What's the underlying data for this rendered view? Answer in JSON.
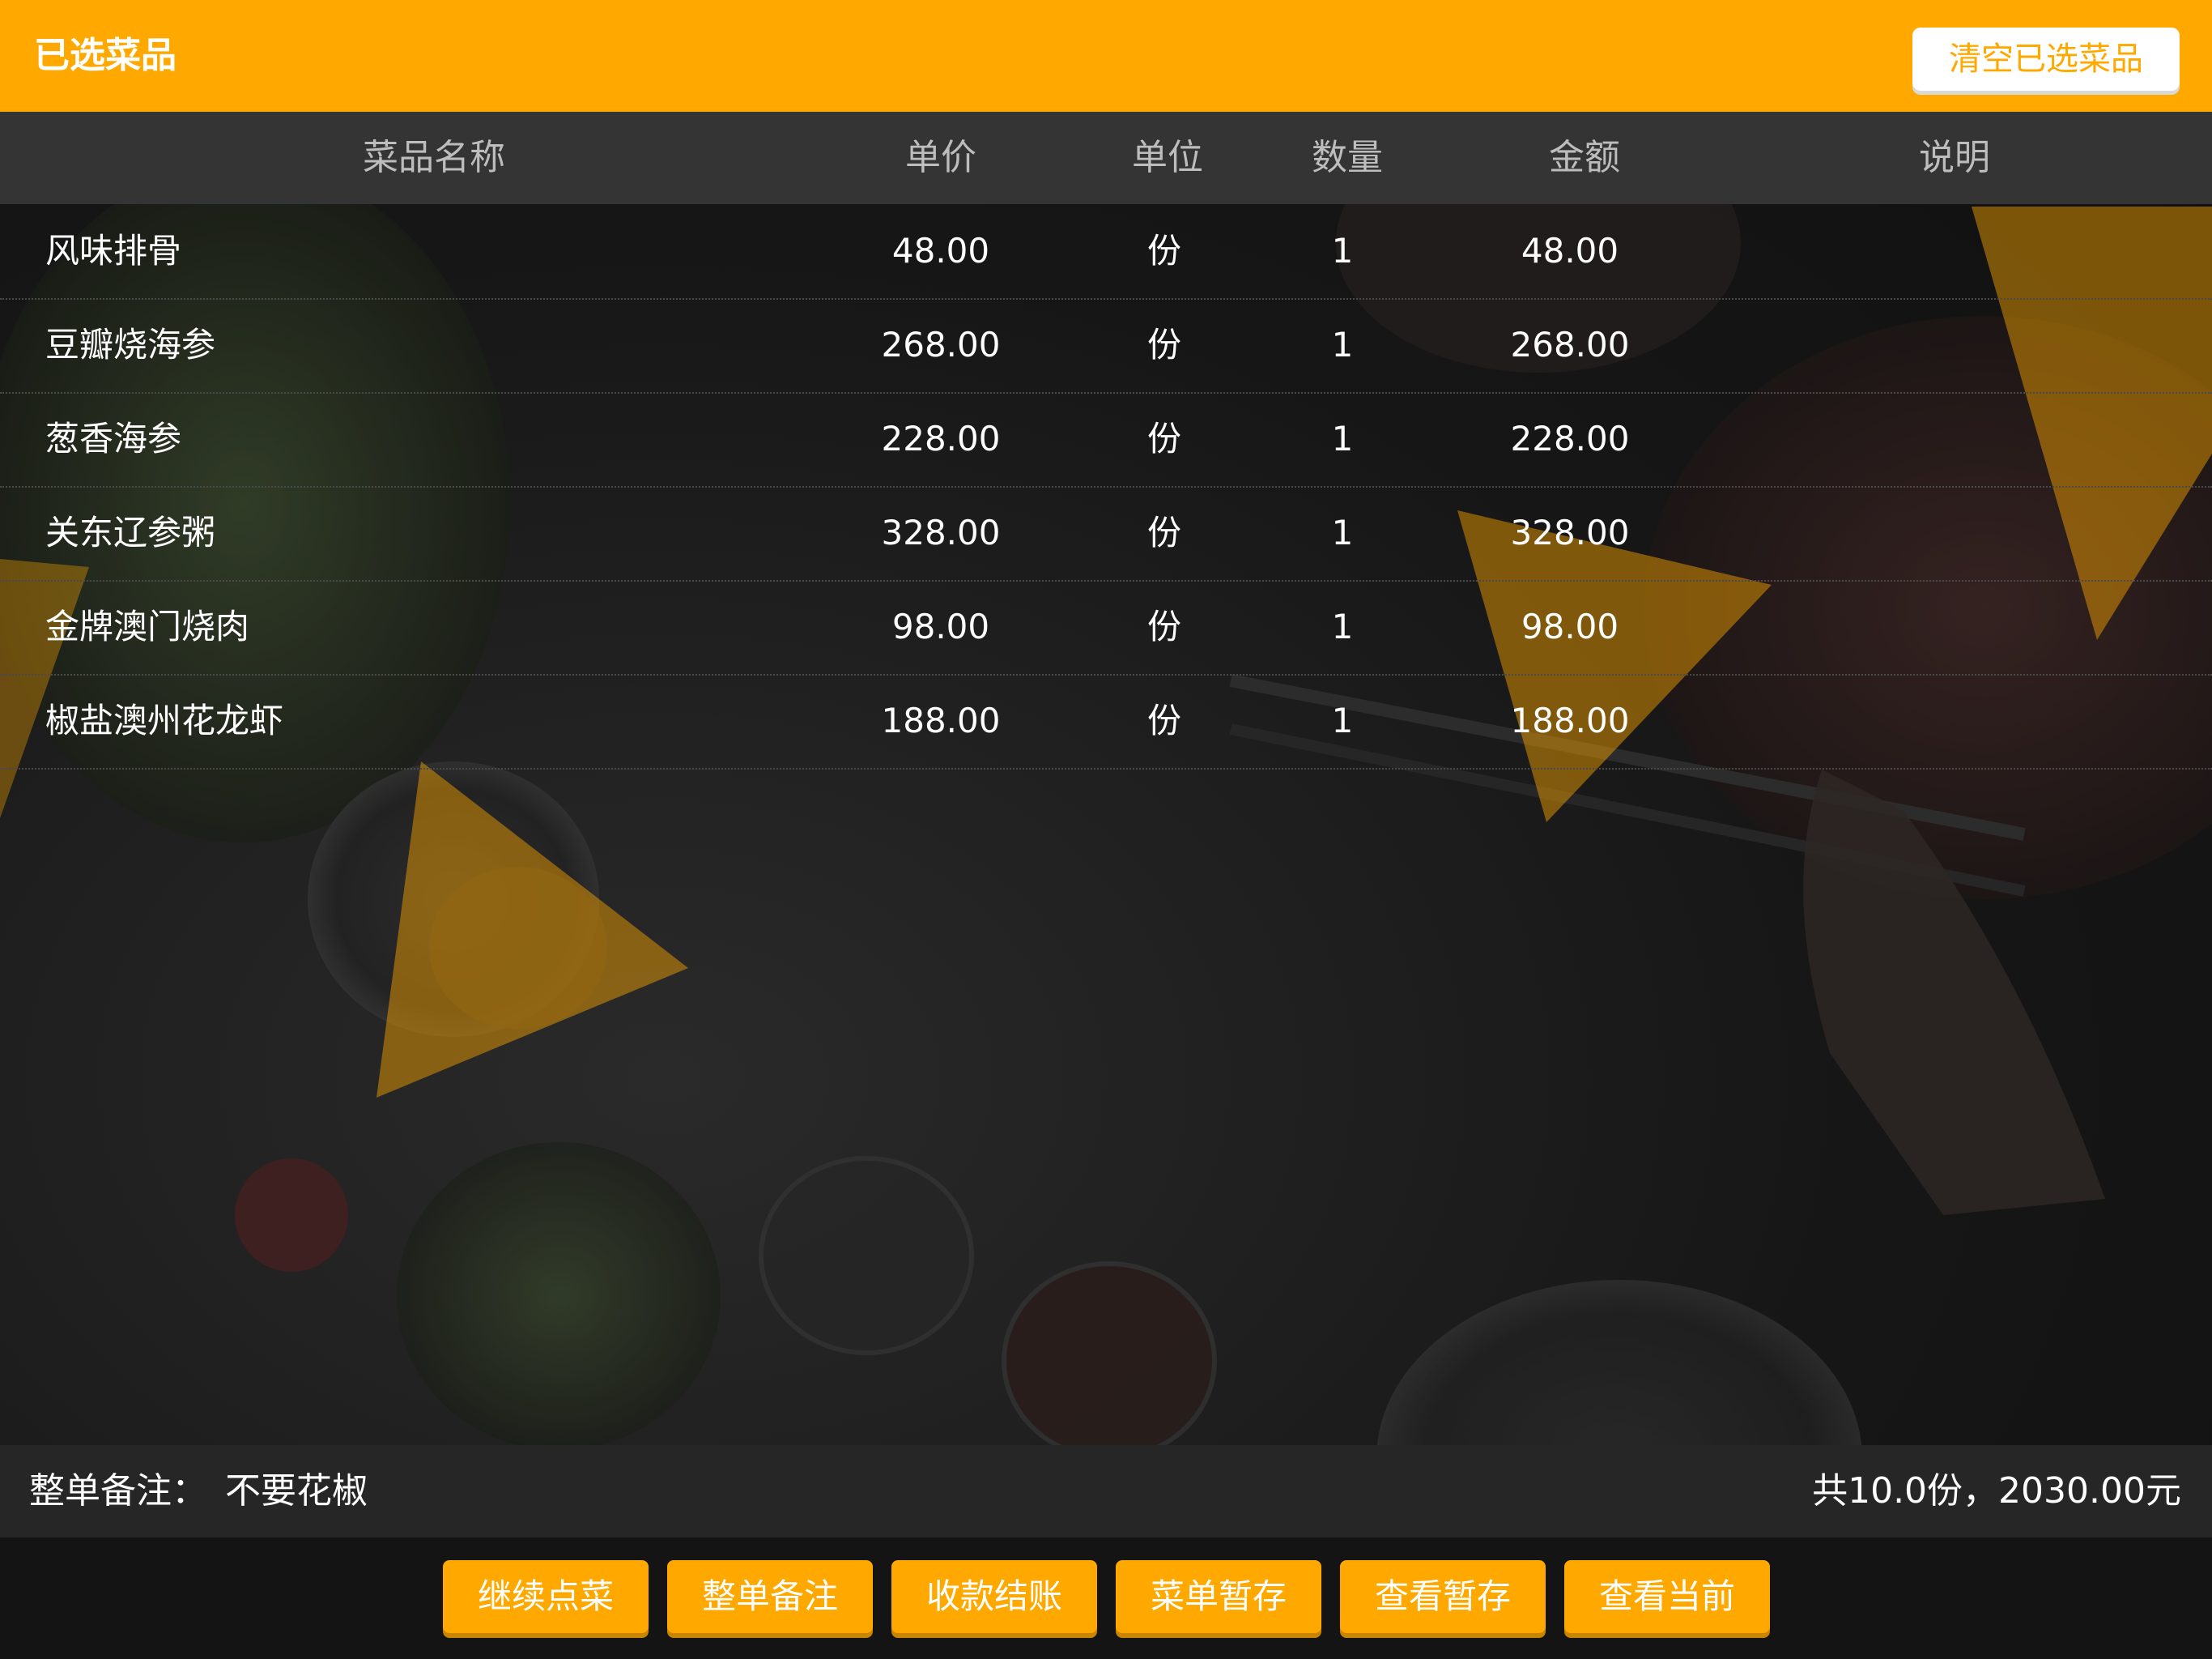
{
  "header": {
    "title": "已选菜品",
    "clear_label": "清空已选菜品"
  },
  "table": {
    "columns": {
      "name": "菜品名称",
      "price": "单价",
      "unit": "单位",
      "qty": "数量",
      "amount": "金额",
      "note": "说明"
    },
    "rows": [
      {
        "name": "风味排骨",
        "price": "48.00",
        "unit": "份",
        "qty": "1",
        "amount": "48.00",
        "note": ""
      },
      {
        "name": "豆瓣烧海参",
        "price": "268.00",
        "unit": "份",
        "qty": "1",
        "amount": "268.00",
        "note": ""
      },
      {
        "name": "葱香海参",
        "price": "228.00",
        "unit": "份",
        "qty": "1",
        "amount": "228.00",
        "note": ""
      },
      {
        "name": "关东辽参粥",
        "price": "328.00",
        "unit": "份",
        "qty": "1",
        "amount": "328.00",
        "note": ""
      },
      {
        "name": "金牌澳门烧肉",
        "price": "98.00",
        "unit": "份",
        "qty": "1",
        "amount": "98.00",
        "note": ""
      },
      {
        "name": "椒盐澳州花龙虾",
        "price": "188.00",
        "unit": "份",
        "qty": "1",
        "amount": "188.00",
        "note": ""
      }
    ]
  },
  "summary": {
    "remark_label": "整单备注：",
    "remark_value": "不要花椒",
    "total": "共10.0份，2030.00元"
  },
  "actions": [
    "继续点菜",
    "整单备注",
    "收款结账",
    "菜单暂存",
    "查看暂存",
    "查看当前"
  ],
  "colors": {
    "accent": "#FFA800",
    "header_row_bg": "#343434",
    "summary_bg": "#262626",
    "text": "#FFFFFF"
  }
}
